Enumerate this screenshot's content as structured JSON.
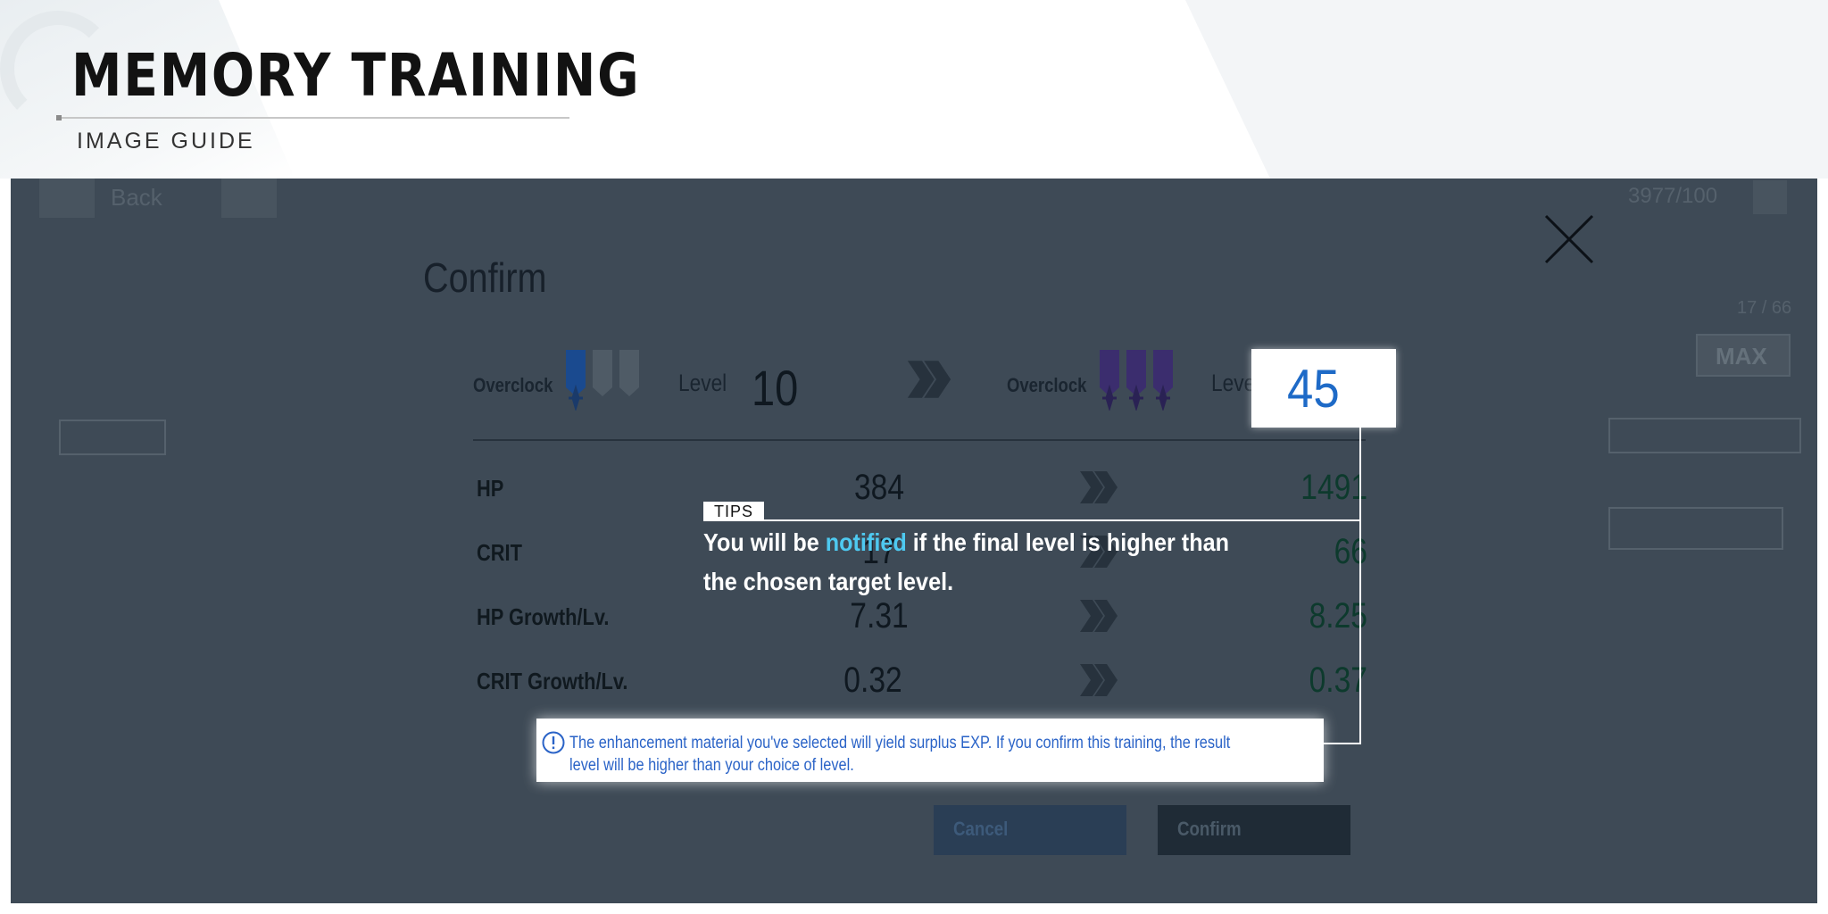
{
  "header": {
    "title": "MEMORY TRAINING",
    "subtitle": "IMAGE GUIDE"
  },
  "dialog": {
    "title": "Confirm",
    "current": {
      "overclock_label": "Overclock",
      "level_label": "Level",
      "level": "10",
      "overclock_filled": 1,
      "overclock_total": 3
    },
    "target": {
      "overclock_label": "Overclock",
      "level_label": "Level",
      "level": "45",
      "overclock_filled": 3,
      "overclock_total": 3
    },
    "stats": [
      {
        "label": "HP",
        "before": "384",
        "after": "1491"
      },
      {
        "label": "CRIT",
        "before": "17",
        "after": "66"
      },
      {
        "label": "HP Growth/Lv.",
        "before": "7.31",
        "after": "8.25"
      },
      {
        "label": "CRIT Growth/Lv.",
        "before": "0.32",
        "after": "0.37"
      }
    ],
    "notice": "The enhancement material you've selected will yield surplus EXP. If you confirm this training, the result level will be higher than your choice of level.",
    "cancel_label": "Cancel",
    "confirm_label": "Confirm"
  },
  "tips": {
    "tag": "TIPS",
    "text_before": "You will be ",
    "text_highlight": "notified",
    "text_after": " if the final level is higher than the chosen target level."
  },
  "background": {
    "back_label": "Back",
    "currency": "3977/100",
    "level_progress": "17 / 66",
    "max_label": "MAX"
  },
  "colors": {
    "screen_overlay": "#3e4a56",
    "level_highlight": "#1e6ac7",
    "tips_highlight": "#4ec9f0",
    "notice_text": "#2a63c7",
    "stat_after": "#0d3a2d"
  }
}
